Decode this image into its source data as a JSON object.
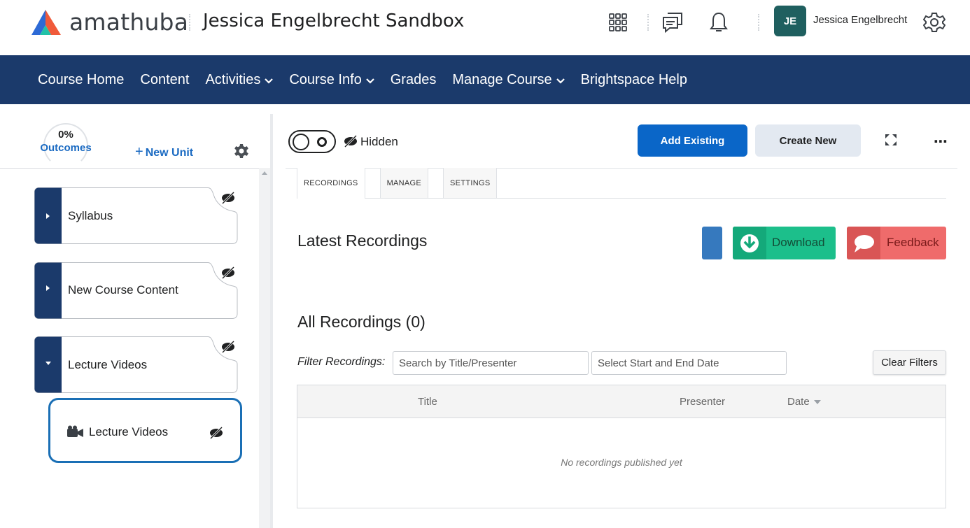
{
  "header": {
    "logo_text": "amathuba",
    "org_title": "Jessica Engelbrecht Sandbox",
    "user_initials": "JE",
    "user_name": "Jessica Engelbrecht",
    "avatar_color": "#1f5f5f"
  },
  "nav": {
    "background": "#1b3a6b",
    "items": [
      {
        "label": "Course Home",
        "has_menu": false
      },
      {
        "label": "Content",
        "has_menu": false
      },
      {
        "label": "Activities",
        "has_menu": true
      },
      {
        "label": "Course Info",
        "has_menu": true
      },
      {
        "label": "Grades",
        "has_menu": false
      },
      {
        "label": "Manage Course",
        "has_menu": true
      },
      {
        "label": "Brightspace Help",
        "has_menu": false
      }
    ]
  },
  "sidebar": {
    "outcomes_percent": "0%",
    "outcomes_label": "Outcomes",
    "new_unit_label": "New Unit",
    "units": [
      {
        "label": "Syllabus",
        "expanded": false,
        "hidden": true
      },
      {
        "label": "New Course Content",
        "expanded": false,
        "hidden": true
      },
      {
        "label": "Lecture Videos",
        "expanded": true,
        "hidden": true
      }
    ],
    "selected_lesson": {
      "label": "Lecture Videos",
      "hidden": true
    }
  },
  "main": {
    "visibility_label": "Hidden",
    "add_existing_label": "Add Existing",
    "create_new_label": "Create New",
    "tabs": [
      {
        "label": "RECORDINGS",
        "active": true
      },
      {
        "label": "MANAGE",
        "active": false
      },
      {
        "label": "SETTINGS",
        "active": false
      }
    ],
    "latest_title": "Latest Recordings",
    "download_label": "Download",
    "feedback_label": "Feedback",
    "all_title": "All Recordings (0)",
    "filter_label": "Filter Recordings:",
    "search_placeholder": "Search by Title/Presenter",
    "date_placeholder": "Select Start and End Date",
    "clear_filters_label": "Clear Filters",
    "table": {
      "columns": [
        "Title",
        "Presenter",
        "Date"
      ],
      "empty_message": "No recordings published yet"
    },
    "colors": {
      "primary": "#0a66c8",
      "download": "#1cbf8b",
      "feedback": "#ef6b6b",
      "selected_border": "#1a6fb5"
    }
  }
}
